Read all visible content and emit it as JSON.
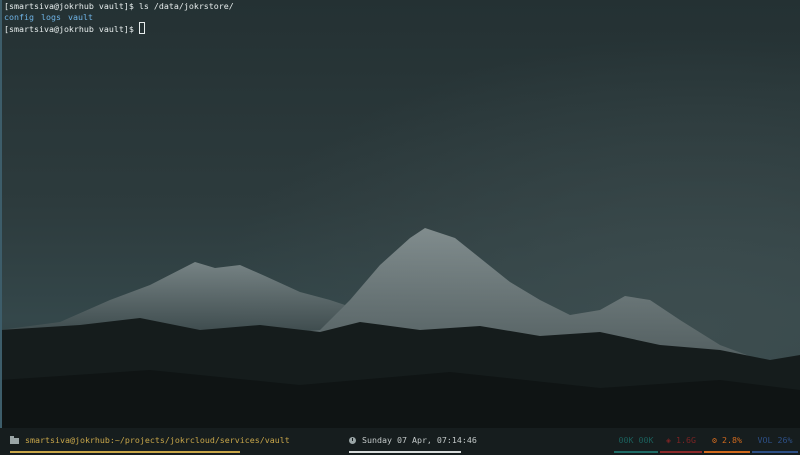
{
  "terminal": {
    "prompt": "[smartsiva@jokrhub vault]$ ",
    "command": "ls /data/jokrstore/",
    "listing": [
      "config",
      "logs",
      "vault"
    ]
  },
  "statusbar": {
    "path_icon": "folder-icon",
    "path": "smartsiva@jokrhub:~/projects/jokrcloud/services/vault",
    "clock_icon": "clock-icon",
    "datetime": "Sunday 07 Apr, 07:14:46",
    "network": "00K 00K",
    "memory_icon": "memory-icon",
    "memory": "1.6G",
    "cpu_icon": "cpu-icon",
    "cpu": "2.8%",
    "volume": "VOL 26%"
  },
  "colors": {
    "path_accent": "#c8a64a",
    "network": "#1e6b66",
    "memory": "#8b2a2a",
    "cpu": "#d06a1e",
    "volume": "#2d4f85",
    "directory": "#6fb4e6"
  }
}
